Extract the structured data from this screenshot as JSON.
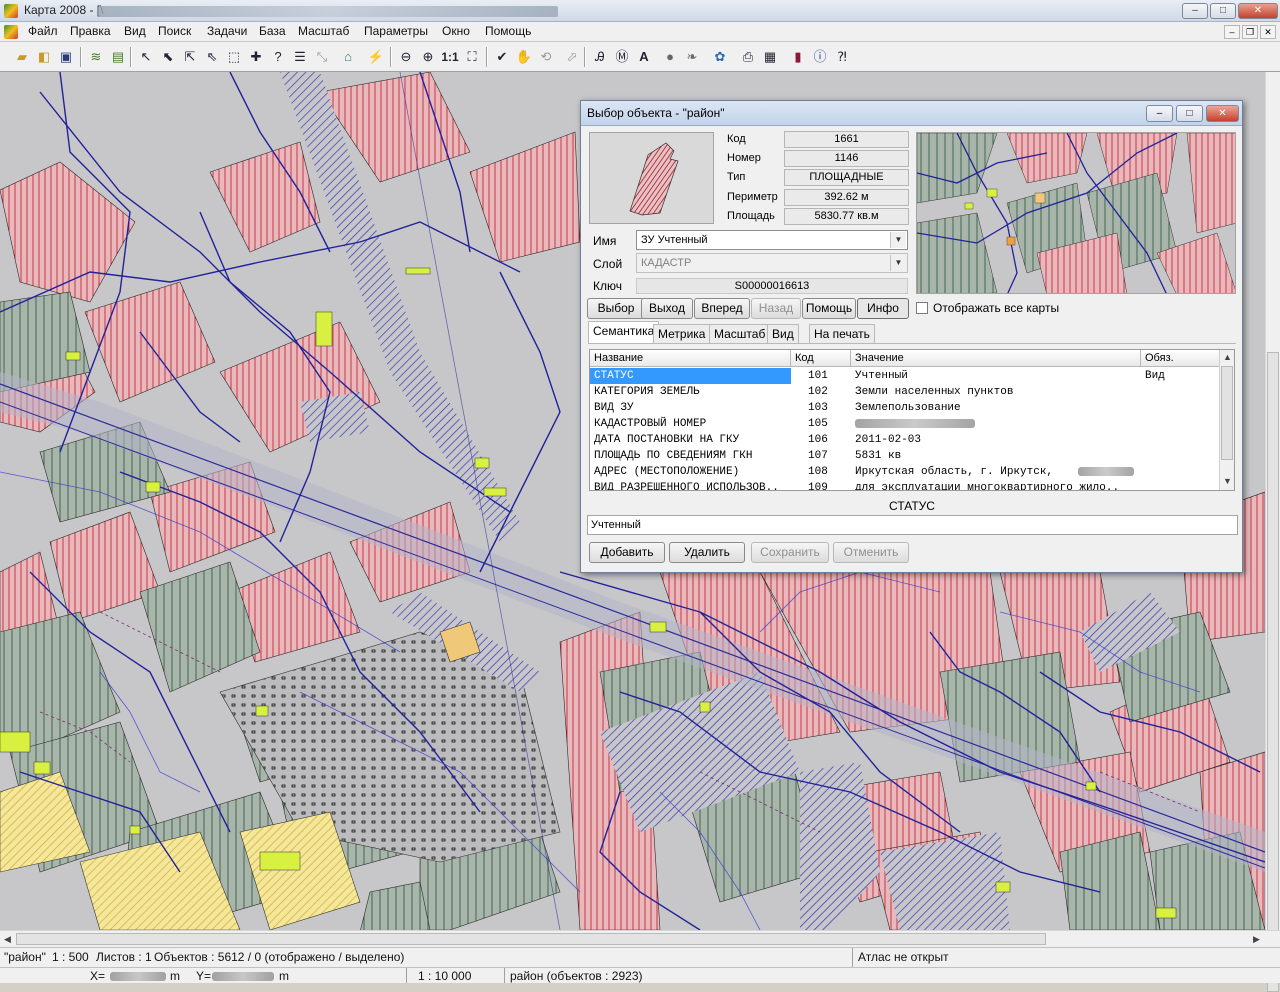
{
  "window": {
    "title": "Карта 2008 - [\\",
    "buttons": {
      "minimize": "–",
      "maximize": "□",
      "close": "✕"
    }
  },
  "menu": {
    "items": [
      "Файл",
      "Правка",
      "Вид",
      "Поиск",
      "Задачи",
      "База",
      "Масштаб",
      "Параметры",
      "Окно",
      "Помощь"
    ],
    "mdi_buttons": {
      "minimize": "–",
      "restore": "❐",
      "close": "✕"
    }
  },
  "toolbar": {
    "scale_one": "1:1"
  },
  "dialog": {
    "title": "Выбор объекта - \"район\"",
    "fields": {
      "code_label": "Код",
      "code_value": "1661",
      "number_label": "Номер",
      "number_value": "1146",
      "type_label": "Тип",
      "type_value": "ПЛОЩАДНЫЕ",
      "perimeter_label": "Периметр",
      "perimeter_value": "392.62  м",
      "area_label": "Площадь",
      "area_value": "5830.77  кв.м"
    },
    "name_label": "Имя",
    "name_value": "ЗУ Учтенный",
    "layer_label": "Слой",
    "layer_value": "КАДАСТР",
    "key_label": "Ключ",
    "key_value": "S00000016613",
    "buttons": {
      "select": "Выбор",
      "exit": "Выход",
      "forward": "Вперед",
      "back": "Назад",
      "help": "Помощь",
      "info": "Инфо"
    },
    "show_all_maps": "Отображать все карты",
    "tabs": [
      "Семантика",
      "Метрика",
      "Масштаб",
      "Вид",
      "На печать"
    ],
    "grid": {
      "headers": {
        "name": "Название",
        "code": "Код",
        "value": "Значение",
        "required": "Обяз."
      },
      "rows": [
        {
          "name": "СТАТУС",
          "code": "101",
          "value": "Учтенный",
          "required": "Вид"
        },
        {
          "name": "КАТЕГОРИЯ ЗЕМЕЛЬ",
          "code": "102",
          "value": "Земли населенных пунктов",
          "required": ""
        },
        {
          "name": "ВИД ЗУ",
          "code": "103",
          "value": "Землепользование",
          "required": ""
        },
        {
          "name": "КАДАСТРОВЫЙ НОМЕР",
          "code": "105",
          "value": "",
          "required": ""
        },
        {
          "name": "ДАТА ПОСТАНОВКИ НА ГКУ",
          "code": "106",
          "value": "2011-02-03",
          "required": ""
        },
        {
          "name": "ПЛОЩАДЬ ПО СВЕДЕНИЯМ ГКН",
          "code": "107",
          "value": "5831 кв",
          "required": ""
        },
        {
          "name": "АДРЕС (МЕСТОПОЛОЖЕНИЕ)",
          "code": "108",
          "value": "Иркутская область, г. Иркутск,",
          "required": ""
        },
        {
          "name": "ВИД РАЗРЕШЕННОГО ИСПОЛЬЗОВ..",
          "code": "109",
          "value": "для эксплуатации многоквартирного жило..",
          "required": ""
        }
      ]
    },
    "status_caption": "СТАТУС",
    "status_value": "Учтенный",
    "bottom_buttons": {
      "add": "Добавить",
      "delete": "Удалить",
      "save": "Сохранить",
      "cancel": "Отменить"
    }
  },
  "statusbar": {
    "map_name": "\"район\"",
    "scale": "1 : 500",
    "sheets": "Листов : 1",
    "objects": "Объектов : 5612 / 0 (отображено / выделено)",
    "atlas": "Атлас не открыт",
    "x_label": "X=",
    "x_unit": "m",
    "y_label": "Y=",
    "y_unit": "m",
    "view_scale": "1 : 10 000",
    "layer_info": "район  (объектов : 2923)"
  },
  "colors": {
    "map_background": "#c7c7c9",
    "pink_parcel": "#e8b8bc",
    "hatch_red": "#c43a46",
    "green_parcel": "#a9b4ab",
    "hatch_green": "#3e6a50",
    "network_blue": "#22229a",
    "yellow_green": "#d8f040",
    "orange_parcel": "#f0c87a",
    "selection_blue": "#3399ff"
  }
}
